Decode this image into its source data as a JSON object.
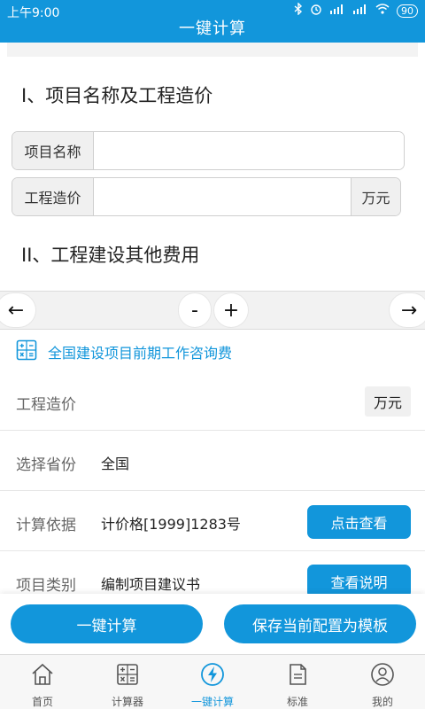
{
  "status_bar": {
    "time": "上午9:00",
    "battery": "90"
  },
  "header": {
    "title": "一键计算"
  },
  "section1": {
    "heading": "I、项目名称及工程造价",
    "name_label": "项目名称",
    "name_value": "",
    "cost_label": "工程造价",
    "cost_value": "",
    "cost_unit": "万元"
  },
  "section2": {
    "heading": "II、工程建设其他费用"
  },
  "nav": {
    "prev": "←",
    "minus": "-",
    "plus": "+",
    "next": "→"
  },
  "calc": {
    "title": "全国建设项目前期工作咨询费",
    "cost_label": "工程造价",
    "cost_unit": "万元",
    "province_label": "选择省份",
    "province_value": "全国",
    "basis_label": "计算依据",
    "basis_value": "计价格[1999]1283号",
    "basis_button": "点击查看",
    "type_label": "项目类别",
    "type_value": "编制项目建议书",
    "type_button": "查看说明"
  },
  "actions": {
    "calc": "一键计算",
    "save": "保存当前配置为模板"
  },
  "tabs": [
    {
      "label": "首页",
      "icon": "home-icon"
    },
    {
      "label": "计算器",
      "icon": "calculator-icon"
    },
    {
      "label": "一键计算",
      "icon": "lightning-icon",
      "active": true
    },
    {
      "label": "标准",
      "icon": "document-icon"
    },
    {
      "label": "我的",
      "icon": "user-icon"
    }
  ],
  "colors": {
    "primary": "#1296db",
    "active_tab": "#1296db"
  }
}
